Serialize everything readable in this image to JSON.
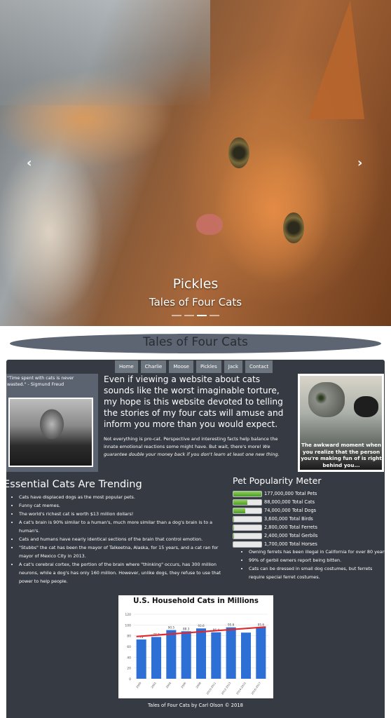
{
  "carousel": {
    "title": "Pickles",
    "subtitle": "Tales of Four Cats",
    "prev_icon": "chevron-left-icon",
    "next_icon": "chevron-right-icon",
    "prev_glyph": "‹",
    "next_glyph": "›",
    "slide_count": 4,
    "active_slide": 3
  },
  "header": {
    "title": "Tales of Four Cats"
  },
  "nav": {
    "items": [
      "Home",
      "Charlie",
      "Moose",
      "Pickles",
      "Jack",
      "Contact"
    ]
  },
  "quote": {
    "text": "\"Time spent with cats is never wasted.\" - Sigmund Freud"
  },
  "intro": {
    "large": "Even if viewing a website about cats sounds like the worst imaginable torture, my hope is this website devoted to telling the stories of my four cats will amuse and inform you more than you would expect.",
    "small": "Not everything is pro-cat. Perspective and interesting facts help balance the innate emotional reactions some might have. But wait, there's more!",
    "italic": "We guarantee double your money back if you don't learn at least one new thing."
  },
  "meme": {
    "caption": "The awkward moment when you realize that the person you're making fun of is right behind you..."
  },
  "trending": {
    "title": "Essential Cats Are Trending",
    "items": [
      "Cats have displaced dogs as the most popular pets.",
      "Funny cat memes.",
      "The world's richest cat is worth $13 million dollars!",
      "A cat's brain is 90% similar to a human's, much more similar than a dog's brain is to a human's.",
      "Cats and humans have nearly identical sections of the brain that control emotion.",
      "\"Stubbs\" the cat has been the mayor of Talkeetna, Alaska, for 15 years, and a cat ran for mayor of Mexico City in 2013.",
      "A cat's cerebral cortex, the portion of the brain where \"thinking\" occurs, has 300 million neurons, while a dog's has only 160 million. However, unlike dogs, they refuse to use that power to help people."
    ]
  },
  "meter": {
    "title": "Pet Popularity Meter",
    "rows": [
      {
        "label": "177,000,000 Total Pets",
        "fill": 1.0
      },
      {
        "label": "88,000,000 Total Cats",
        "fill": 0.5
      },
      {
        "label": "74,000,000 Total Dogs",
        "fill": 0.42
      },
      {
        "label": "3,600,000 Total Birds",
        "fill": 0.02
      },
      {
        "label": "2,800,000 Total Ferrets",
        "fill": 0.016
      },
      {
        "label": "2,400,000 Total Gerbils",
        "fill": 0.014
      },
      {
        "label": "1,700,000 Total Horses",
        "fill": 0.01
      }
    ],
    "facts": [
      "Owning ferrets has been illegal in California for over 80 years.",
      "99% of gerbil owners report being bitten.",
      "Cats can be dressed in small dog costumes, but ferrets require special ferret costumes."
    ]
  },
  "chart_data": {
    "type": "bar",
    "title": "U.S. Household Cats in Millions",
    "categories": [
      "2000",
      "2002",
      "2004",
      "2006",
      "2008",
      "2010-2011",
      "2012-2013",
      "2014-2015",
      "2016-2017"
    ],
    "values": [
      73,
      77.7,
      90.5,
      88.3,
      93.6,
      86.4,
      95.6,
      85.8,
      95.6
    ],
    "value_labels": [
      "73",
      "77.7",
      "90.5",
      "88.3",
      "93.6",
      "86.4",
      "95.6",
      "",
      "95.6"
    ],
    "ylim": [
      0,
      120
    ],
    "yticks": [
      0,
      20,
      40,
      60,
      80,
      100,
      120
    ],
    "trendline": true,
    "grid": true,
    "colors": {
      "bar": "#2e6fd6",
      "trend": "#e0282e"
    }
  },
  "footer": {
    "text": "Tales of Four Cats by Carl Olson © 2018"
  }
}
